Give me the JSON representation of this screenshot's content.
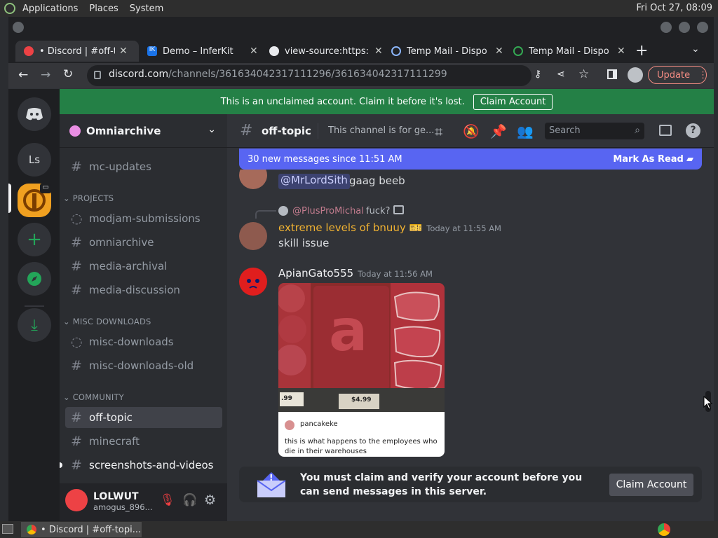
{
  "os": {
    "menus": [
      "Applications",
      "Places",
      "System"
    ],
    "clock": "Fri Oct 27, 08:09"
  },
  "browser": {
    "tabs": [
      {
        "title": "• Discord | #off-topic",
        "active": true
      },
      {
        "title": "Demo – InferKit"
      },
      {
        "title": "view-source:https:"
      },
      {
        "title": "Temp Mail - Dispo"
      },
      {
        "title": "Temp Mail - Dispo"
      }
    ],
    "url_host": "discord.com",
    "url_path": "/channels/361634042317111296/361634042317111299",
    "update_label": "Update"
  },
  "banner": {
    "text": "This is an unclaimed account. Claim it before it's lost.",
    "button": "Claim Account"
  },
  "servers": {
    "ls_label": "Ls"
  },
  "guild": {
    "name": "Omniarchive"
  },
  "channels": {
    "top": [
      {
        "name": "mc-updates",
        "icon": "hash"
      }
    ],
    "categories": [
      {
        "name": "PROJECTS",
        "items": [
          {
            "name": "modjam-submissions",
            "icon": "forum"
          },
          {
            "name": "omniarchive",
            "icon": "hash"
          },
          {
            "name": "media-archival",
            "icon": "hash"
          },
          {
            "name": "media-discussion",
            "icon": "hash"
          }
        ]
      },
      {
        "name": "MISC DOWNLOADS",
        "items": [
          {
            "name": "misc-downloads",
            "icon": "forum"
          },
          {
            "name": "misc-downloads-old",
            "icon": "hash"
          }
        ]
      },
      {
        "name": "COMMUNITY",
        "items": [
          {
            "name": "off-topic",
            "icon": "hash",
            "active": true
          },
          {
            "name": "minecraft",
            "icon": "hash"
          },
          {
            "name": "screenshots-and-videos",
            "icon": "hash"
          }
        ]
      }
    ]
  },
  "user": {
    "name": "LOLWUT",
    "tag": "amogus_896..."
  },
  "chat": {
    "channel": "off-topic",
    "topic": "This channel is for ge...",
    "search_placeholder": "Search",
    "new_messages": "30 new messages since 11:51 AM",
    "mark_read": "Mark As Read",
    "messages": [
      {
        "mention": "@MrLordSith",
        "text": "gaag beeb"
      },
      {
        "reply_to": "@PlusProMichal",
        "reply_text": "fuck?",
        "author": "extreme levels of bnuuy",
        "author_color": "#f0b232",
        "timestamp": "Today at 11:55 AM",
        "text": "skill issue"
      },
      {
        "author": "ApianGato555",
        "timestamp": "Today at 11:56 AM",
        "embed": {
          "price1": ".99",
          "price2": "$4.99",
          "caption_user": "pancakeke",
          "caption": "this is what happens to the employees who die in their warehouses"
        }
      }
    ],
    "claim_notice": "You must claim and verify your account before you can send messages in this server.",
    "claim_button": "Claim Account"
  },
  "taskbar": {
    "window_title": "• Discord | #off-topi..."
  }
}
